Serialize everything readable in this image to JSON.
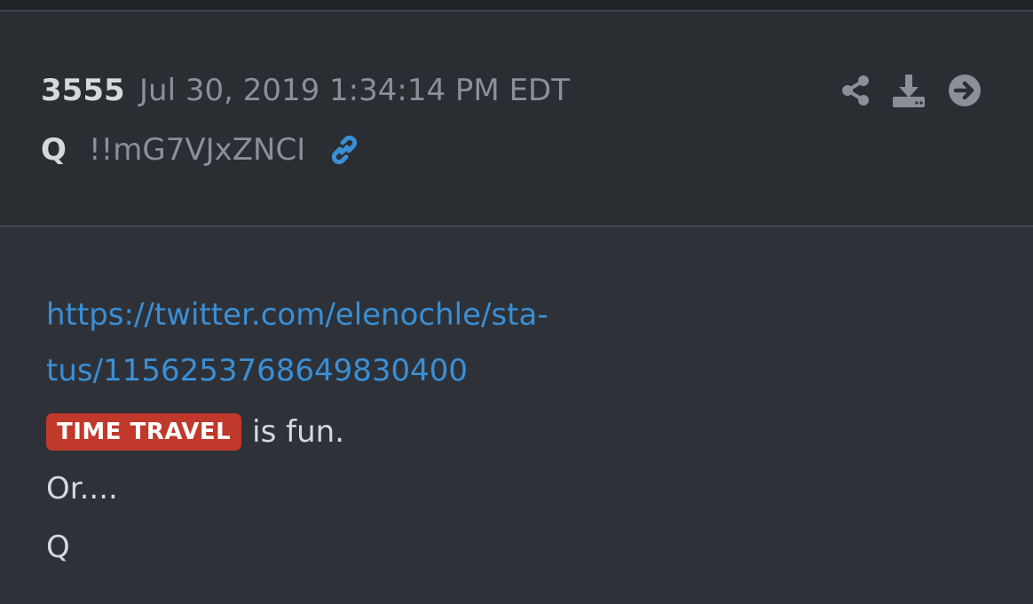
{
  "post": {
    "number": "3555",
    "timestamp": "Jul 30, 2019 1:34:14 PM EDT",
    "author": "Q",
    "tripcode": "!!mG7VJxZNCI",
    "link_line1": "https://twitter.com/elenochle/sta-",
    "link_line2": "tus/1156253768649830400",
    "tag_label": "TIME TRAVEL",
    "tag_suffix": "is fun.",
    "line_or": "Or....",
    "signature": "Q"
  },
  "icons": {
    "link": "link-icon",
    "share": "share-icon",
    "download": "download-icon",
    "goto": "arrow-circle-right-icon"
  },
  "colors": {
    "background": "#2e3238",
    "header_background": "#2a2d32",
    "link": "#3a8fd6",
    "tag": "#c0392b",
    "muted_text": "#8b9097",
    "text": "#d6d8db",
    "icon": "#8b9097"
  }
}
